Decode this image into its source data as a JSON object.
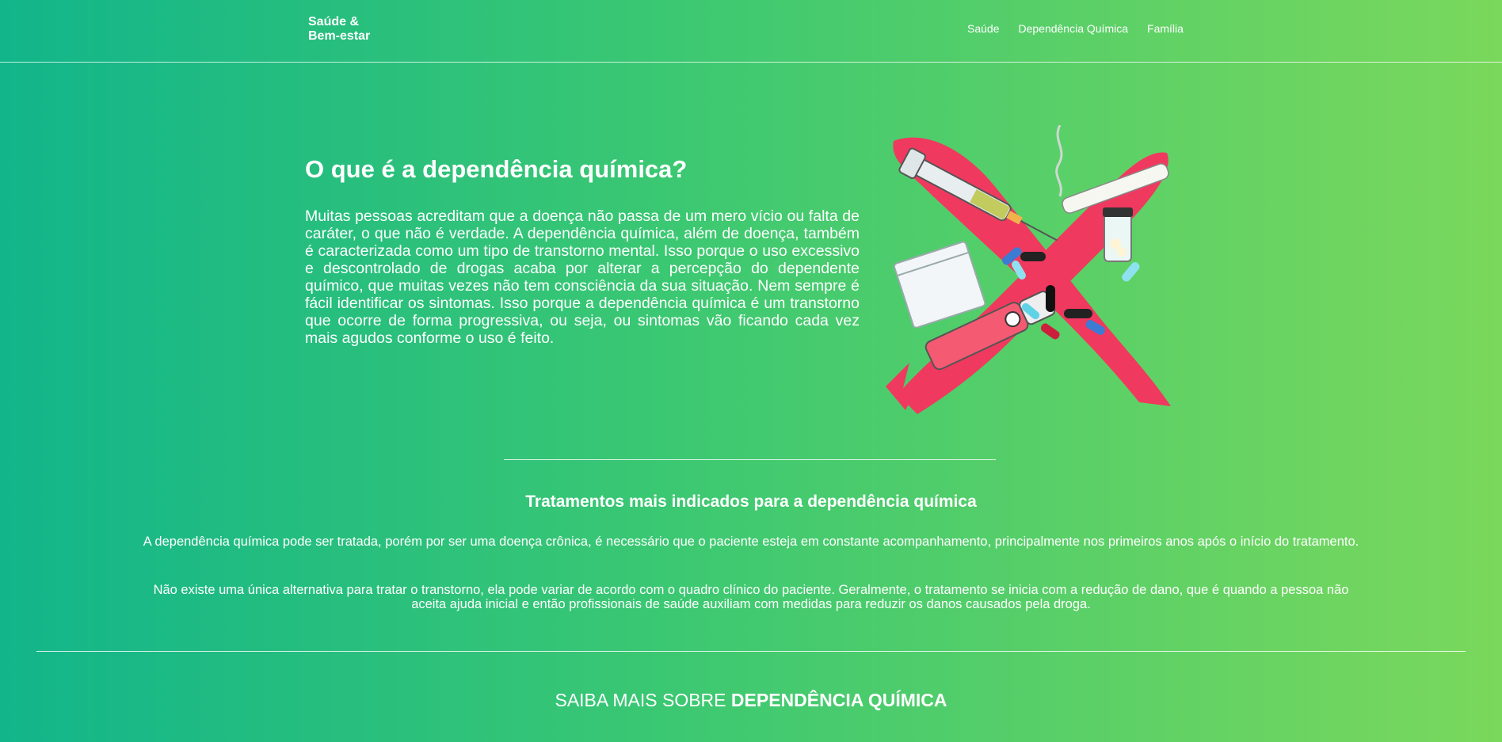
{
  "brand": {
    "line1": "Saúde &",
    "line2": "Bem-estar"
  },
  "nav": {
    "links": [
      "Saúde",
      "Dependência Química",
      "Família"
    ]
  },
  "hero": {
    "title": "O que é a dependência química?",
    "body": "Muitas pessoas acreditam que a doença não passa de um mero vício ou falta de caráter, o que não é verdade. A dependência química, além de doença, também é caracterizada como um tipo de transtorno mental. Isso porque o uso excessivo e descontrolado de drogas acaba por alterar a percepção do dependente químico, que muitas vezes não tem consciência da sua situação. Nem sempre é fácil identificar os sintomas. Isso porque a dependência química é um transtorno que ocorre de forma progressiva, ou seja, ou sintomas vão ficando cada vez mais agudos conforme o uso é feito.",
    "illustration_icon": "drugs-crossed-out-illustration"
  },
  "treatments": {
    "title": "Tratamentos mais indicados para a dependência química",
    "paragraph1": "A dependência química pode ser tratada, porém por ser uma doença crônica, é necessário que o paciente esteja em constante acompanhamento, principalmente nos primeiros anos após o início do tratamento.",
    "paragraph2": "Não existe uma única alternativa para tratar o transtorno, ela pode variar de acordo com o quadro clínico do paciente. Geralmente, o tratamento se inicia com a redução de dano, que é quando a pessoa não aceita ajuda inicial e então profissionais de saúde auxiliam com medidas para reduzir os danos causados pela droga."
  },
  "cta": {
    "prefix": "SAIBA MAIS SOBRE ",
    "emphasis": "DEPENDÊNCIA QUÍMICA"
  },
  "colors": {
    "gradient_start": "#12b58a",
    "gradient_end": "#7ad85c",
    "illustration_red": "#f0395f"
  }
}
